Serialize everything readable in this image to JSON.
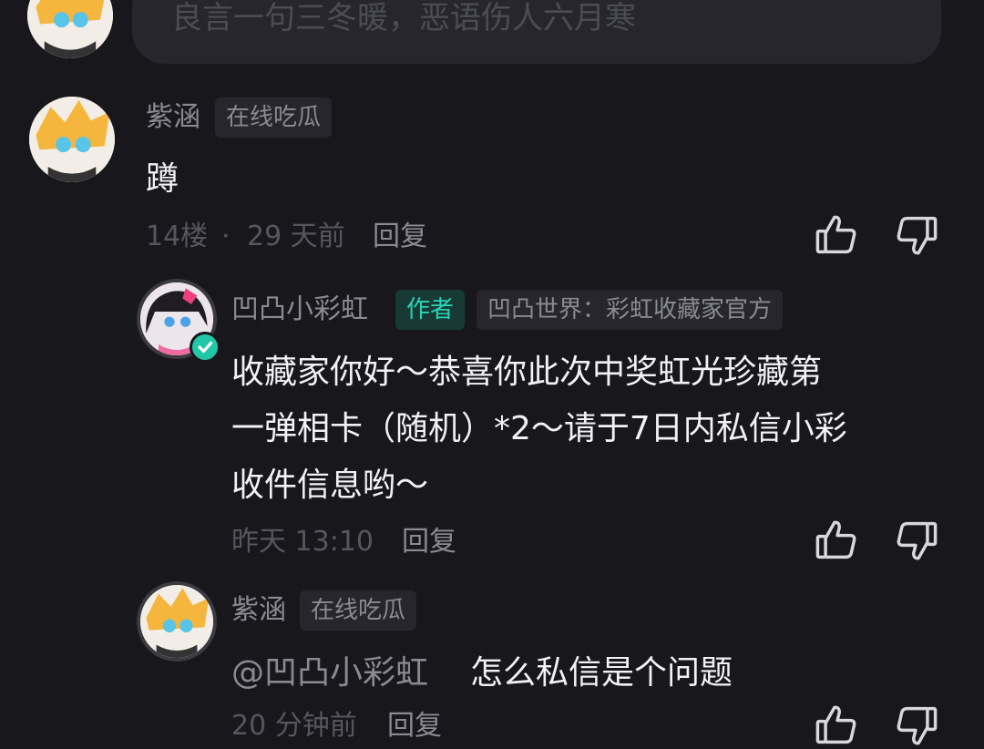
{
  "input": {
    "placeholder": "良言一句三冬暖，恶语伤人六月寒"
  },
  "comments": [
    {
      "username": "紫涵",
      "badge": "在线吃瓜",
      "text": "蹲",
      "floor": "14楼",
      "separator": "·",
      "time": "29 天前",
      "reply_label": "回复"
    },
    {
      "username": "凹凸小彩虹",
      "author_badge": "作者",
      "badge": "凹凸世界：彩虹收藏家官方",
      "lines": [
        "收藏家你好～恭喜你此次中奖虹光珍藏第",
        "一弹相卡（随机）*2～请于7日内私信小彩",
        "收件信息哟～"
      ],
      "time": "昨天 13:10",
      "reply_label": "回复"
    },
    {
      "username": "紫涵",
      "badge": "在线吃瓜",
      "mention": "@凹凸小彩虹",
      "text": "怎么私信是个问题",
      "time": "20 分钟前",
      "reply_label": "回复"
    }
  ],
  "icons": {
    "like": "thumbs-up-icon",
    "dislike": "thumbs-down-icon",
    "verified": "check-badge-icon"
  },
  "colors": {
    "background": "#17171c",
    "accent": "#2bd3b7",
    "muted_text": "#8a8a92"
  }
}
